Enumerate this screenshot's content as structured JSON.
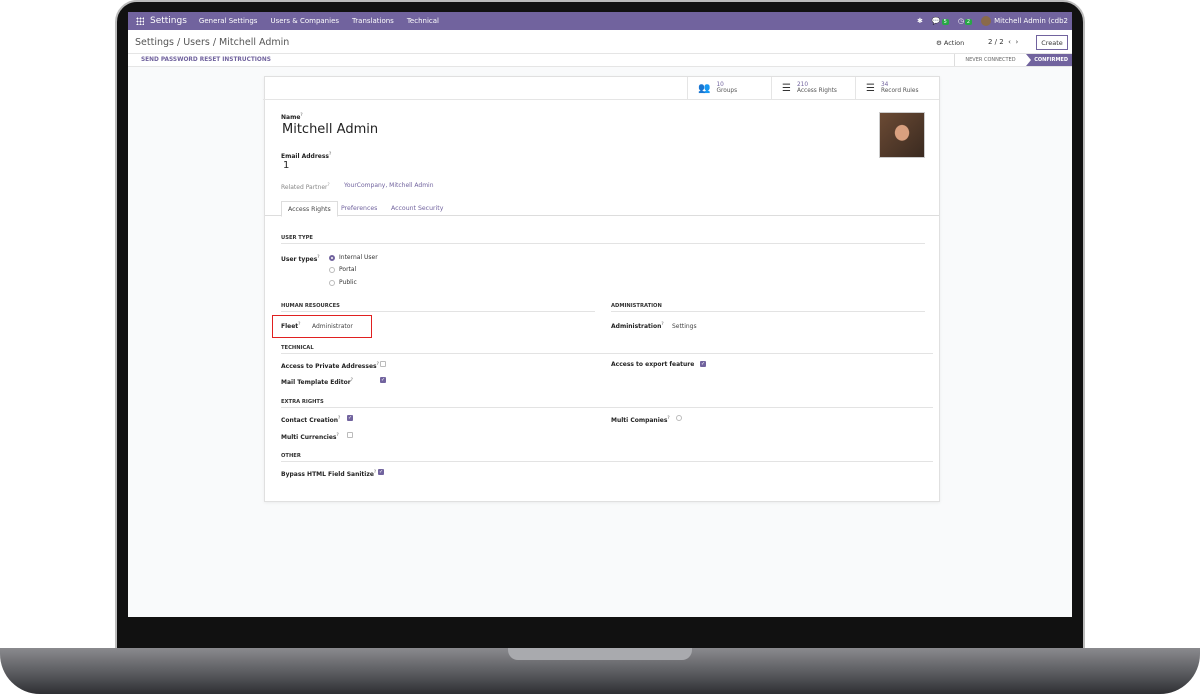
{
  "nav": {
    "app": "Settings",
    "menus": [
      "General Settings",
      "Users & Companies",
      "Translations",
      "Technical"
    ],
    "messages_count": "5",
    "activities_count": "2",
    "user": "Mitchell Admin (cdb2"
  },
  "control": {
    "breadcrumb": "Settings / Users / Mitchell Admin",
    "action": "Action",
    "pager": "2 / 2",
    "create": "Create"
  },
  "statusbar": {
    "reset": "SEND PASSWORD RESET INSTRUCTIONS",
    "states": [
      "NEVER CONNECTED",
      "CONFIRMED"
    ],
    "active": "CONFIRMED"
  },
  "smart_buttons": [
    {
      "count": "10",
      "label": "Groups",
      "icon": "users-icon"
    },
    {
      "count": "210",
      "label": "Access Rights",
      "icon": "list-icon"
    },
    {
      "count": "34",
      "label": "Record Rules",
      "icon": "list-icon"
    }
  ],
  "form": {
    "name_label": "Name",
    "name": "Mitchell Admin",
    "email_label": "Email Address",
    "email": "1",
    "partner_label": "Related Partner",
    "partner": "YourCompany, Mitchell Admin",
    "help": "?"
  },
  "tabs": [
    "Access Rights",
    "Preferences",
    "Account Security"
  ],
  "access": {
    "user_type_title": "USER TYPE",
    "user_types_label": "User types",
    "user_types": [
      "Internal User",
      "Portal",
      "Public"
    ],
    "selected_user_type": "Internal User",
    "hr_title": "HUMAN RESOURCES",
    "fleet_label": "Fleet",
    "fleet_value": "Administrator",
    "admin_title": "ADMINISTRATION",
    "admin_label": "Administration",
    "admin_value": "Settings",
    "technical_title": "TECHNICAL",
    "private_label": "Access to Private Addresses",
    "private": false,
    "mail_label": "Mail Template Editor",
    "mail": true,
    "export_label": "Access to export feature",
    "export": true,
    "extra_title": "EXTRA RIGHTS",
    "contact_label": "Contact Creation",
    "contact": true,
    "currencies_label": "Multi Currencies",
    "currencies": false,
    "companies_label": "Multi Companies",
    "companies": false,
    "other_title": "OTHER",
    "bypass_label": "Bypass HTML Field Sanitize",
    "bypass": true
  },
  "colors": {
    "brand": "#71639e",
    "highlight": "#e02020"
  }
}
